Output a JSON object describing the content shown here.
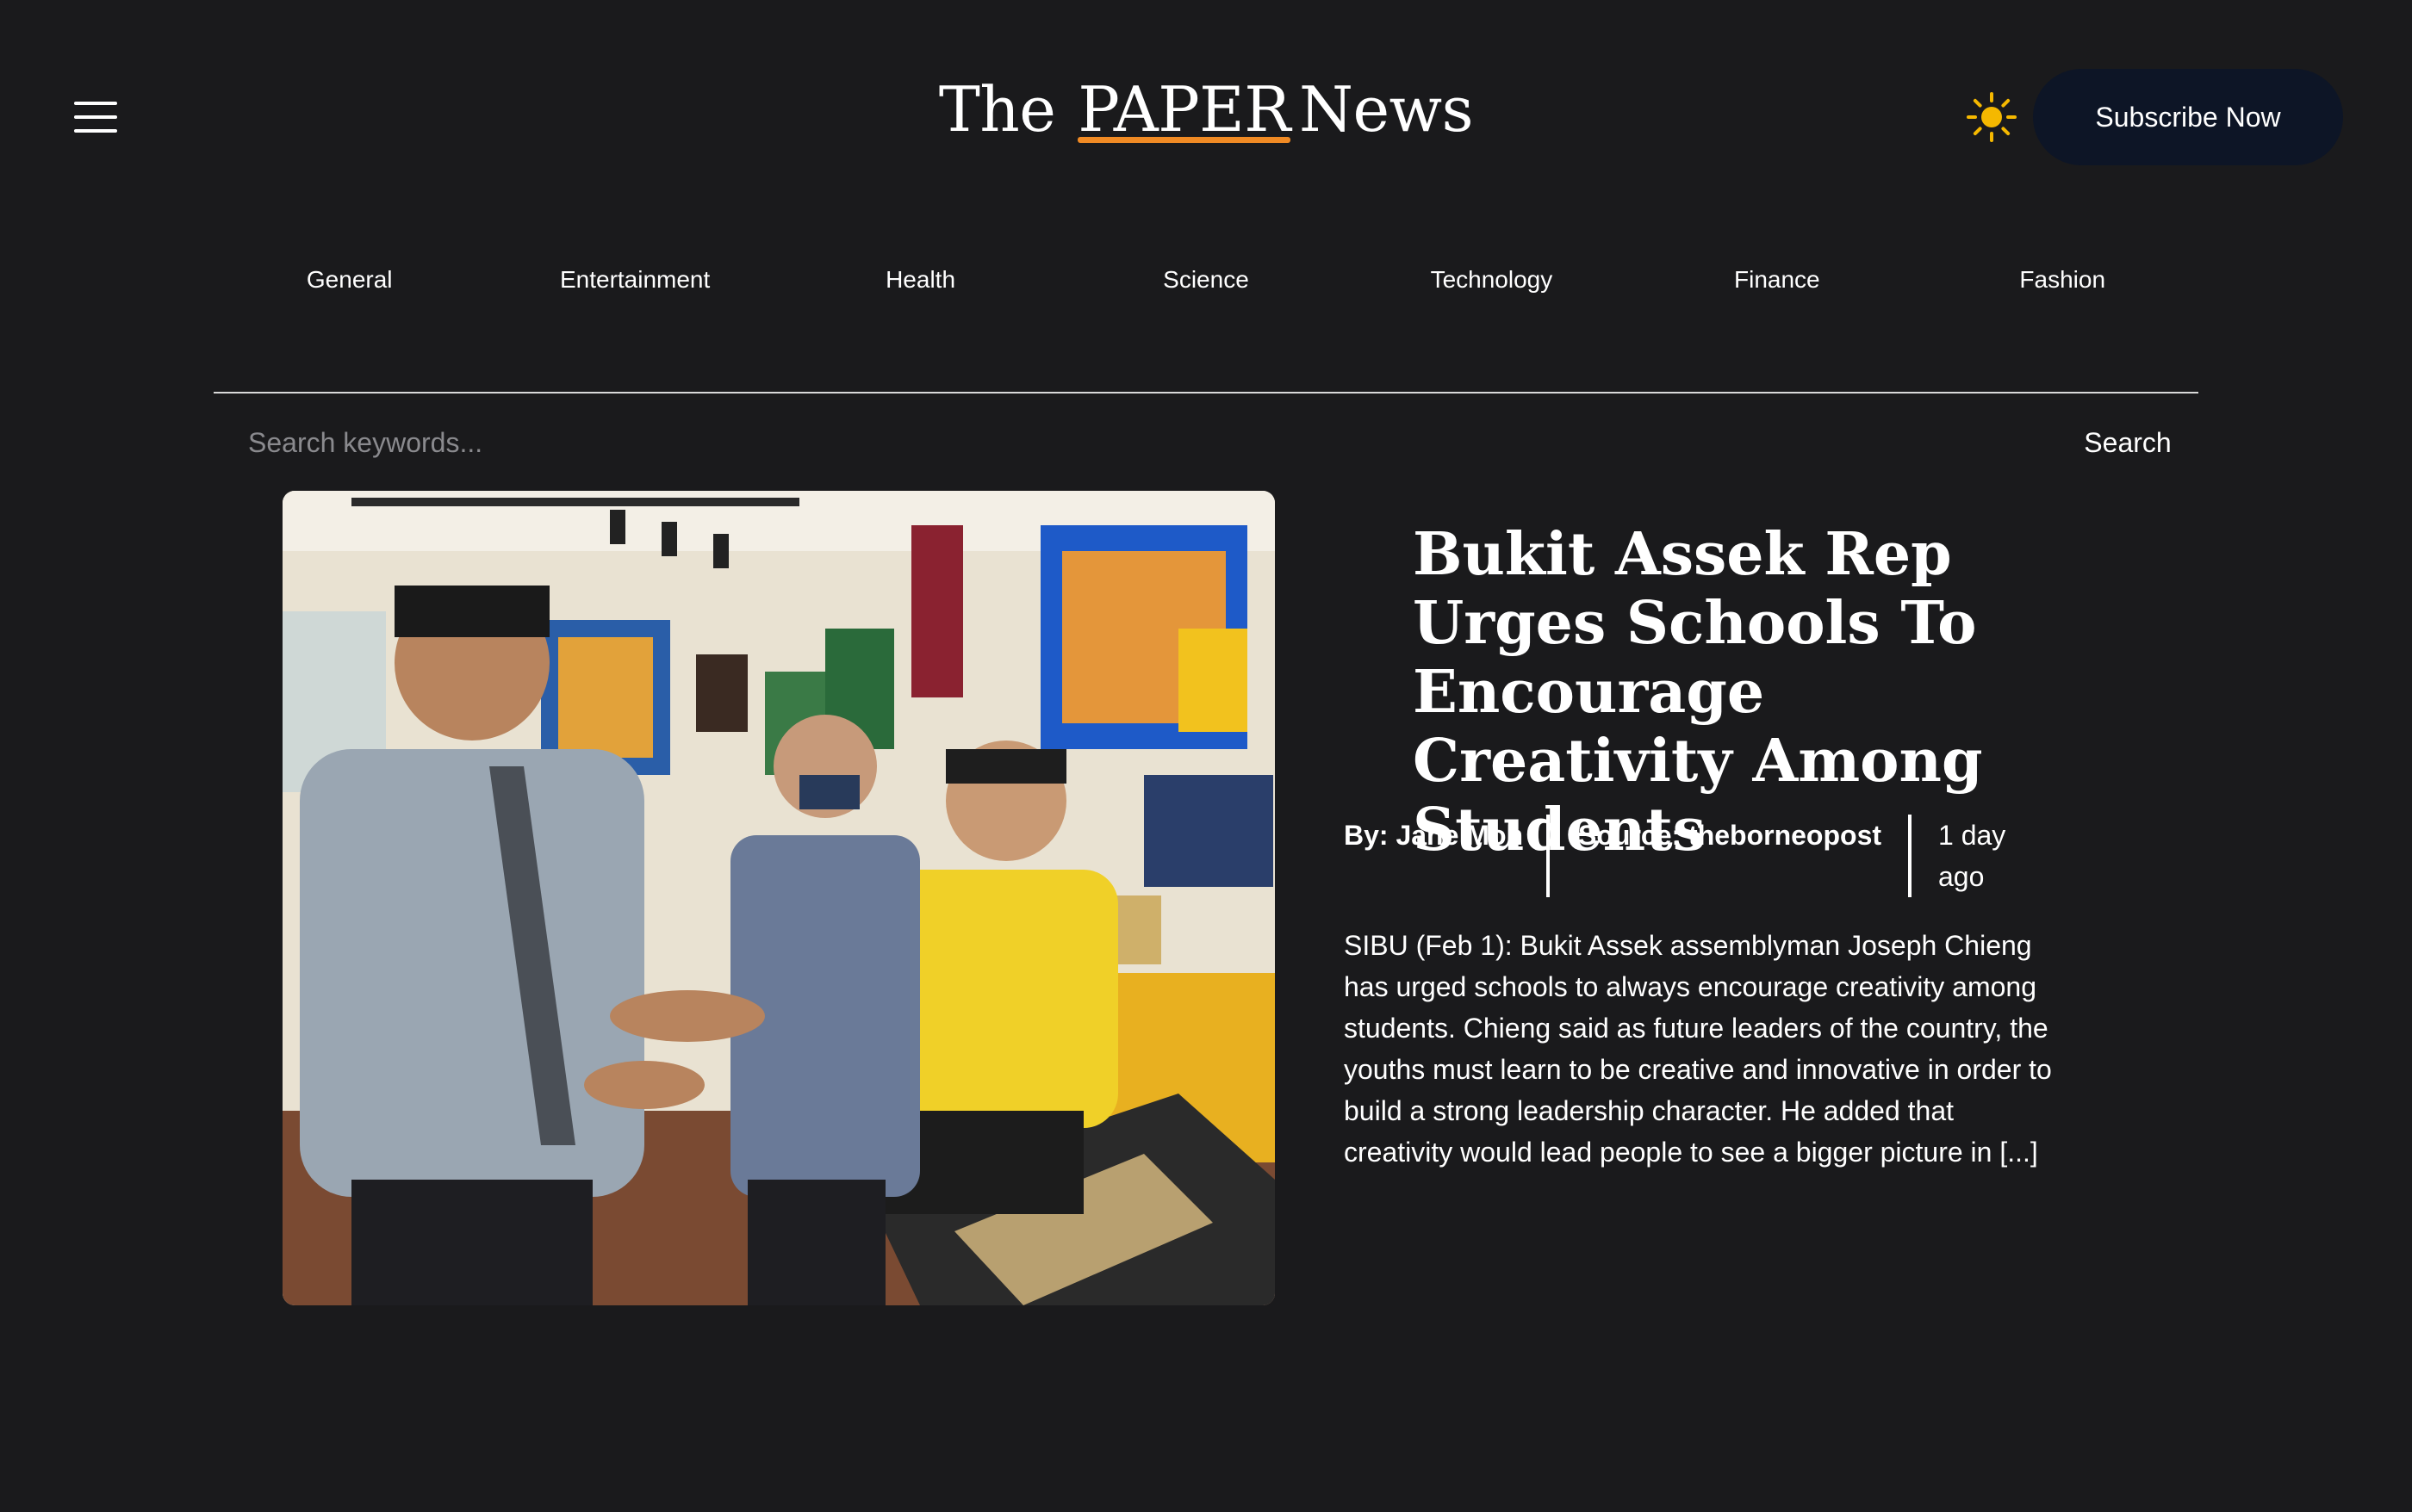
{
  "header": {
    "logo_the": "The",
    "logo_paper": "PAPER",
    "logo_news": "News",
    "menu_icon": "hamburger-menu-icon",
    "theme_icon": "sun-icon",
    "subscribe_label": "Subscribe Now"
  },
  "nav": {
    "items": [
      "General",
      "Entertainment",
      "Health",
      "Science",
      "Technology",
      "Finance",
      "Fashion"
    ]
  },
  "search": {
    "placeholder": "Search keywords...",
    "button_label": "Search"
  },
  "article": {
    "title": "Bukit Assek Rep Urges Schools To Encourage Creativity Among Students",
    "author": "By: Jane Moh",
    "source": "Source: theborneopost",
    "time": "1 day ago",
    "summary": "SIBU (Feb 1): Bukit Assek assemblyman Joseph Chieng has urged schools to always encourage creativity among students. Chieng said as future leaders of the country, the youths must learn to be creative and innovative in order to build a strong leadership character. He added that creativity would lead people to see a bigger picture in [...]"
  },
  "colors": {
    "background": "#1a1a1c",
    "accent": "#f08a24",
    "sun": "#f5b800",
    "subscribe_bg": "#0d1526"
  }
}
